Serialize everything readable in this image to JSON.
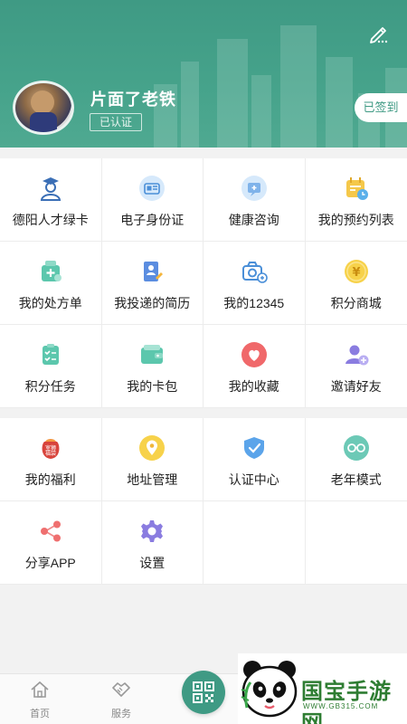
{
  "header": {
    "username": "片面了老铁",
    "verified_badge": "已认证",
    "signin_label": "已签到"
  },
  "services": [
    {
      "label": "德阳人才绿卡",
      "icon": "talent-card-icon"
    },
    {
      "label": "电子身份证",
      "icon": "id-card-icon"
    },
    {
      "label": "健康咨询",
      "icon": "health-consult-icon"
    },
    {
      "label": "我的预约列表",
      "icon": "calendar-icon"
    },
    {
      "label": "我的处方单",
      "icon": "prescription-icon"
    },
    {
      "label": "我投递的简历",
      "icon": "resume-icon"
    },
    {
      "label": "我的12345",
      "icon": "camera-icon"
    },
    {
      "label": "积分商城",
      "icon": "points-mall-icon"
    },
    {
      "label": "积分任务",
      "icon": "task-list-icon"
    },
    {
      "label": "我的卡包",
      "icon": "wallet-icon"
    },
    {
      "label": "我的收藏",
      "icon": "heart-icon"
    },
    {
      "label": "邀请好友",
      "icon": "invite-user-icon"
    }
  ],
  "more": [
    {
      "label": "我的福利",
      "icon": "gift-bag-icon",
      "icon_text": "室狮\n福袋"
    },
    {
      "label": "地址管理",
      "icon": "address-icon"
    },
    {
      "label": "认证中心",
      "icon": "shield-check-icon"
    },
    {
      "label": "老年模式",
      "icon": "glasses-icon"
    },
    {
      "label": "分享APP",
      "icon": "share-icon"
    },
    {
      "label": "设置",
      "icon": "gear-icon"
    }
  ],
  "tabbar": {
    "home": "首页",
    "service": "服务"
  },
  "watermark": {
    "title": "国宝手游网",
    "url": "WWW.GB315.COM"
  },
  "colors": {
    "brand": "#3f9a84",
    "brand_light": "#4fa991"
  }
}
